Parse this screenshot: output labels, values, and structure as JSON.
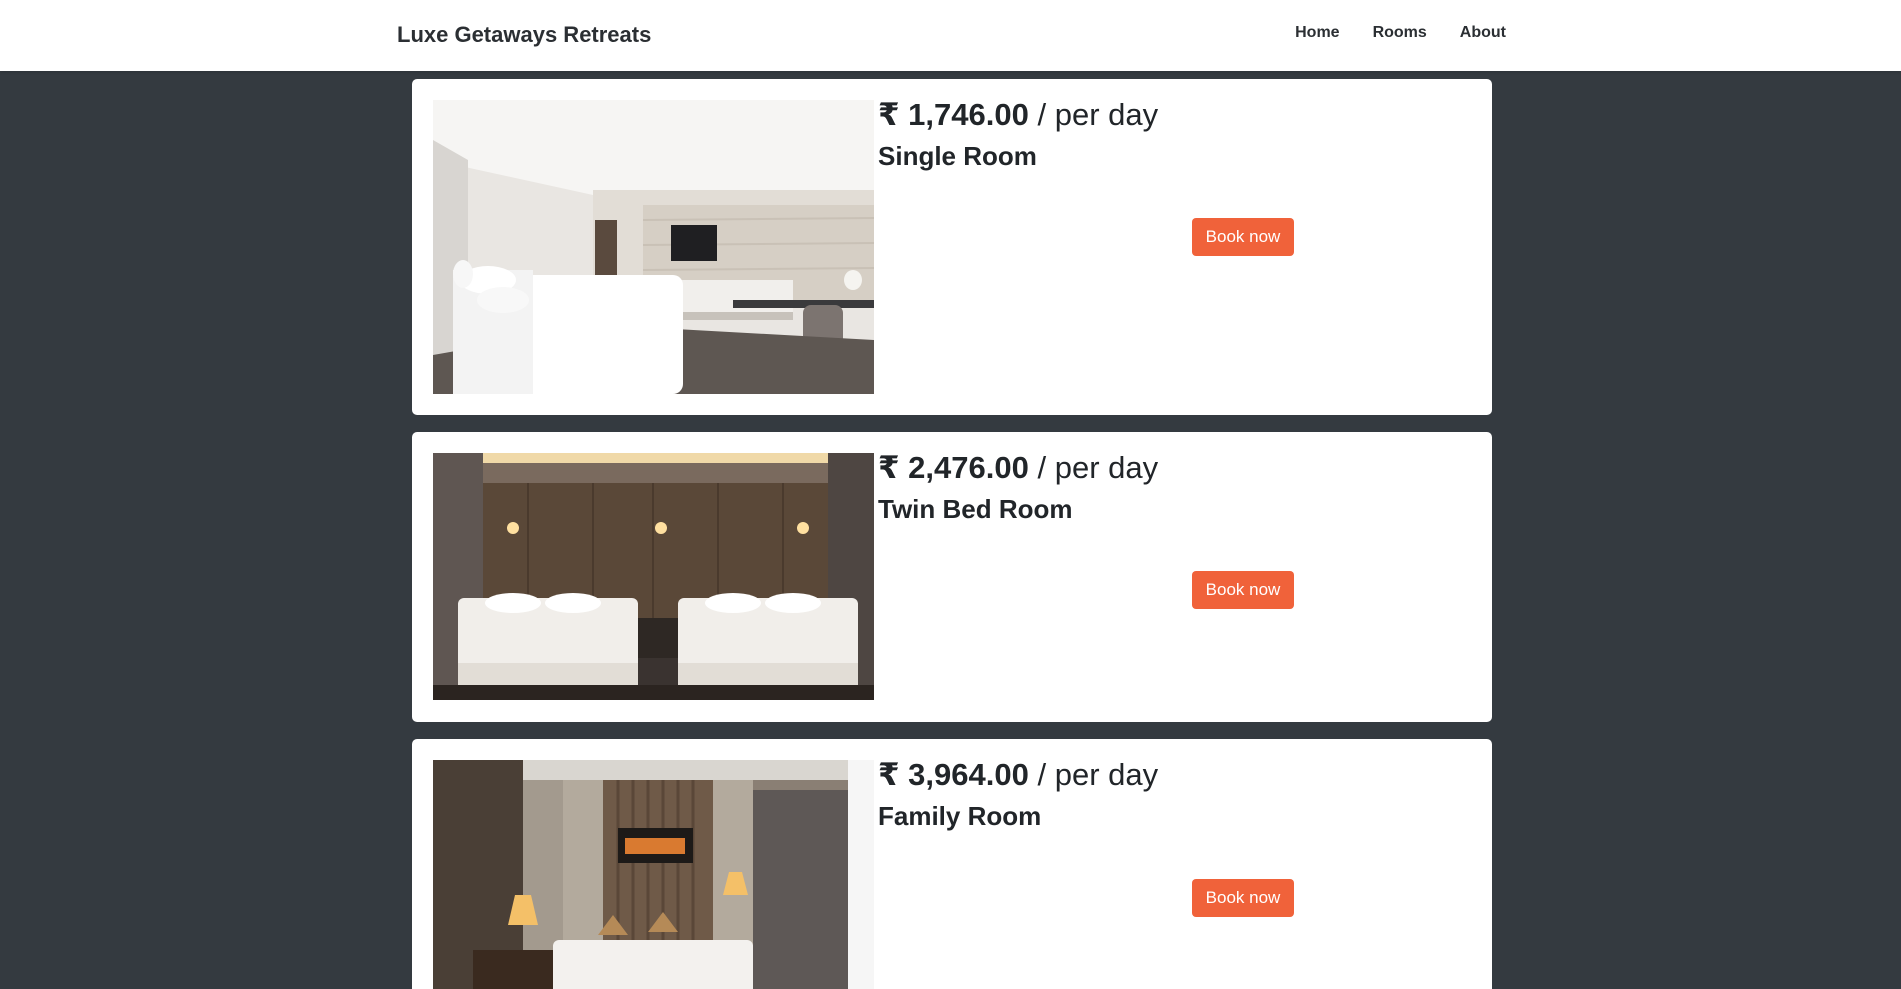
{
  "header": {
    "brand": "Luxe Getaways Retreats",
    "nav": [
      {
        "label": "Home"
      },
      {
        "label": "Rooms"
      },
      {
        "label": "About"
      }
    ]
  },
  "rooms": [
    {
      "amount": "₹ 1,746.00",
      "per": "/ per day",
      "name": "Single Room",
      "button": "Book now",
      "image": "single-room-photo"
    },
    {
      "amount": "₹ 2,476.00",
      "per": "/ per day",
      "name": "Twin Bed Room",
      "button": "Book now",
      "image": "twin-bed-room-photo"
    },
    {
      "amount": "₹ 3,964.00",
      "per": "/ per day",
      "name": "Family Room",
      "button": "Book now",
      "image": "family-room-photo"
    }
  ],
  "colors": {
    "page_background": "#343a40",
    "accent": "#f0623a",
    "card": "#ffffff"
  }
}
